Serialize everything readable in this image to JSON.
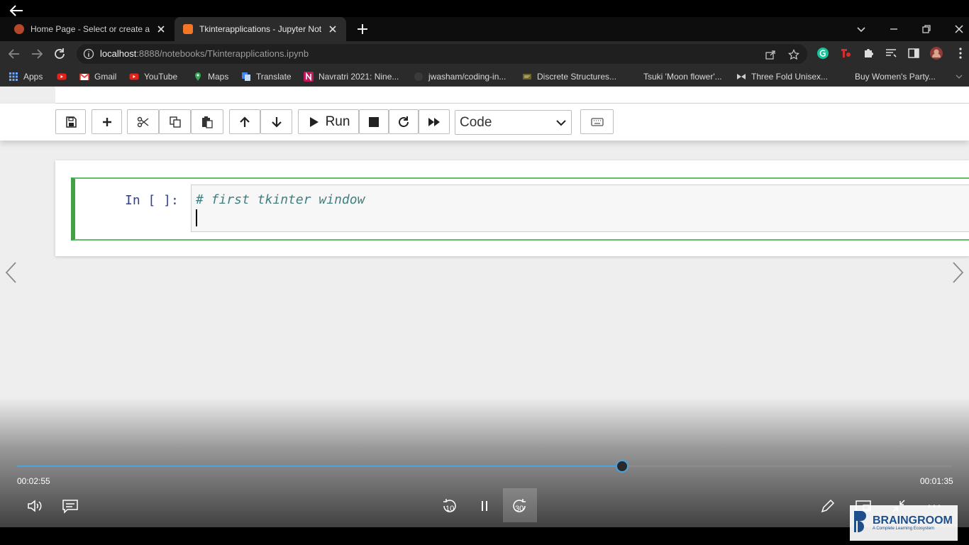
{
  "browser": {
    "tabs": [
      {
        "title": "Home Page - Select or create a n",
        "favicon_color": "#e05a2b",
        "active": false
      },
      {
        "title": "Tkinterapplications - Jupyter Not",
        "favicon_color": "#f37626",
        "active": true
      }
    ],
    "url_host": "localhost",
    "url_rest": ":8888/notebooks/Tkinterapplications.ipynb",
    "bookmarks": [
      {
        "label": "Apps",
        "icon": "apps-grid-icon",
        "color": "#6fa8ff"
      },
      {
        "label": "",
        "icon": "youtube-icon",
        "color": "#e62117"
      },
      {
        "label": "Gmail",
        "icon": "gmail-icon",
        "color": "#ea4335"
      },
      {
        "label": "YouTube",
        "icon": "youtube-icon",
        "color": "#e62117"
      },
      {
        "label": "Maps",
        "icon": "maps-pin-icon",
        "color": "#34a853"
      },
      {
        "label": "Translate",
        "icon": "translate-icon",
        "color": "#4285f4"
      },
      {
        "label": "Navratri 2021: Nine...",
        "icon": "n-logo-icon",
        "color": "#c2185b"
      },
      {
        "label": "jwasham/coding-in...",
        "icon": "github-icon",
        "color": "#3a3a3a"
      },
      {
        "label": "Discrete Structures...",
        "icon": "book-icon",
        "color": "#b5a642"
      },
      {
        "label": "Tsuki 'Moon flower'...",
        "icon": "page-icon",
        "color": "#2b2b2b"
      },
      {
        "label": "Three Fold Unisex...",
        "icon": "bowtie-icon",
        "color": "#cfcfcf"
      },
      {
        "label": "Buy Women's Party...",
        "icon": "page-icon",
        "color": "#2b2b2b"
      }
    ]
  },
  "jupyter": {
    "toolbar": {
      "run_label": "Run",
      "cell_type": "Code"
    },
    "cell": {
      "prompt": "In [ ]:",
      "code": "# first tkinter window"
    }
  },
  "player": {
    "elapsed": "00:02:55",
    "remaining": "00:01:35",
    "progress_fraction": 0.6475,
    "skip_back": "10",
    "skip_forward": "30",
    "accent": "#4aa3df"
  },
  "watermark": {
    "name": "BRAINGROOM",
    "tagline": "A Complete Learning Ecosystem"
  }
}
